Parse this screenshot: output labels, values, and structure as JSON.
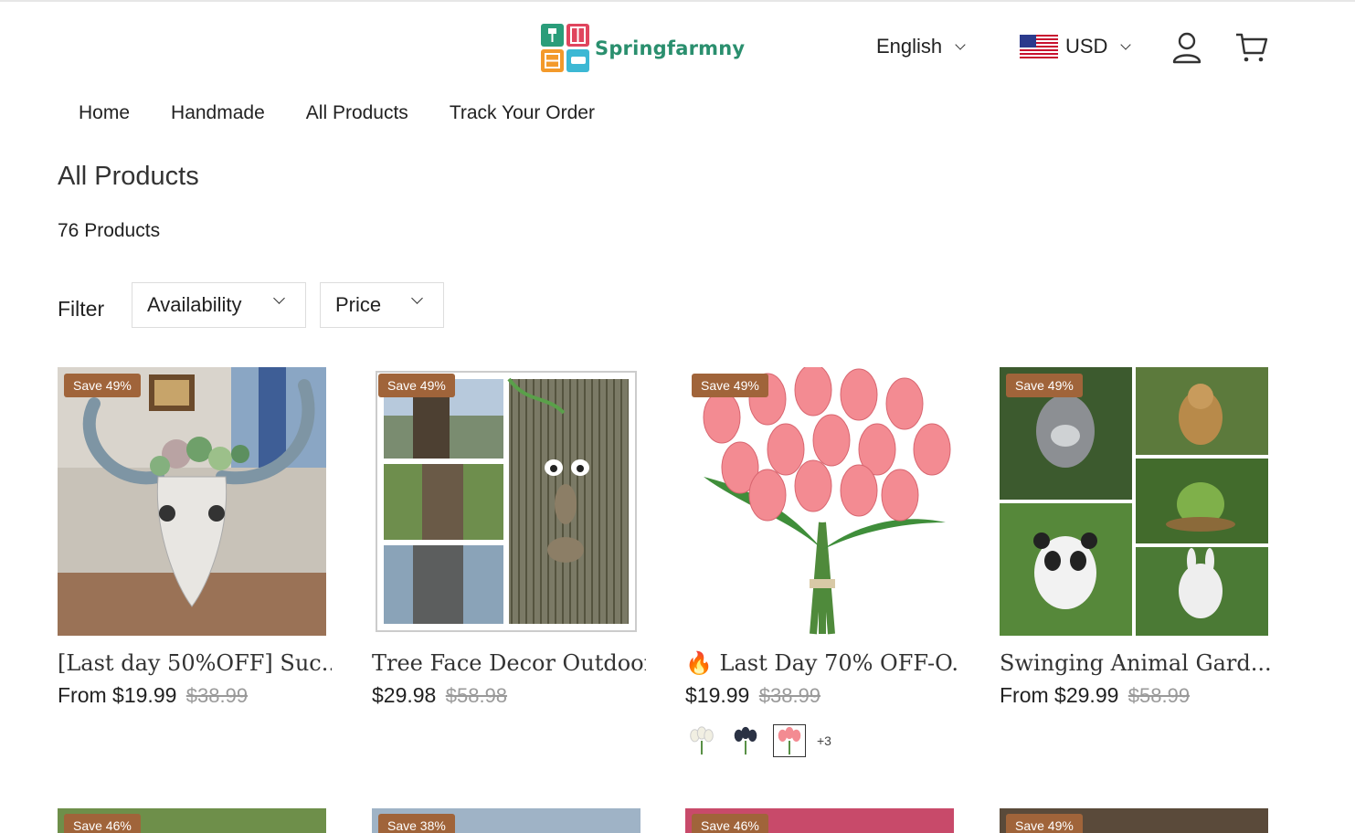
{
  "header": {
    "logo_text": "Springfarmny",
    "language": "English",
    "currency": "USD"
  },
  "nav": [
    "Home",
    "Handmade",
    "All Products",
    "Track Your Order"
  ],
  "page": {
    "title": "All Products",
    "count": "76 Products"
  },
  "filter": {
    "label": "Filter",
    "availability": "Availability",
    "price": "Price"
  },
  "products": [
    {
      "badge": "Save 49%",
      "title": "[Last day 50%OFF] Suc...",
      "price": "From $19.99",
      "old_price": "$38.99"
    },
    {
      "badge": "Save 49%",
      "title": "Tree Face Decor Outdoor",
      "price": "$29.98",
      "old_price": "$58.98"
    },
    {
      "badge": "Save 49%",
      "title": "🔥 Last Day 70% OFF-O...",
      "price": "$19.99",
      "old_price": "$38.99",
      "more_swatches": "+3"
    },
    {
      "badge": "Save 49%",
      "title": "Swinging Animal Gard...",
      "price": "From $29.99",
      "old_price": "$58.99"
    }
  ],
  "products_row2": [
    {
      "badge": "Save 46%"
    },
    {
      "badge": "Save 38%"
    },
    {
      "badge": "Save 46%"
    },
    {
      "badge": "Save 49%"
    }
  ],
  "colors": {
    "badge": "#a0643a",
    "logo_green": "#2a8f6e"
  }
}
